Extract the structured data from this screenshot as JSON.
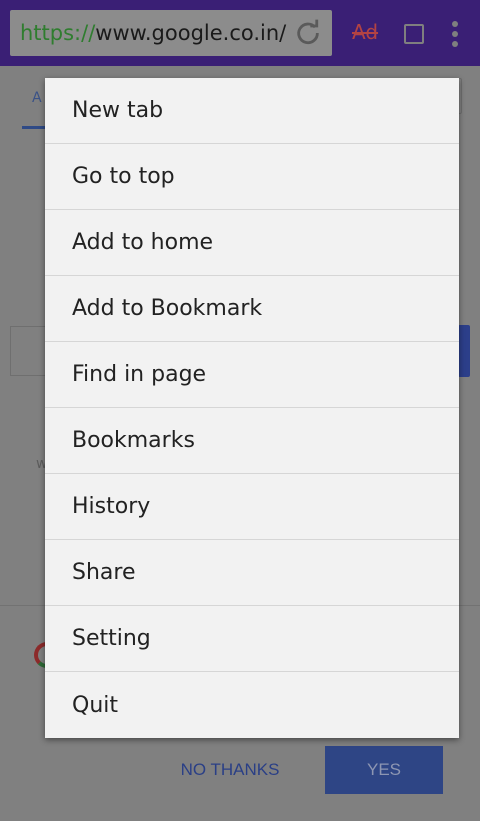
{
  "toolbar": {
    "url_scheme": "https://",
    "url_rest": "www.google.co.in/",
    "adblock_label": "Ad"
  },
  "page": {
    "tab_initial": "A",
    "ghost_text": "w",
    "no_thanks_label": "NO THANKS",
    "yes_label": "YES"
  },
  "menu": {
    "items": [
      {
        "label": "New tab"
      },
      {
        "label": "Go to top"
      },
      {
        "label": "Add to home"
      },
      {
        "label": "Add to Bookmark"
      },
      {
        "label": "Find in page"
      },
      {
        "label": "Bookmarks"
      },
      {
        "label": "History"
      },
      {
        "label": "Share"
      },
      {
        "label": "Setting"
      },
      {
        "label": "Quit"
      }
    ]
  },
  "colors": {
    "toolbar_bg": "#3a1f75",
    "menu_bg": "#f2f2f2",
    "accent_blue": "#2e4585"
  }
}
